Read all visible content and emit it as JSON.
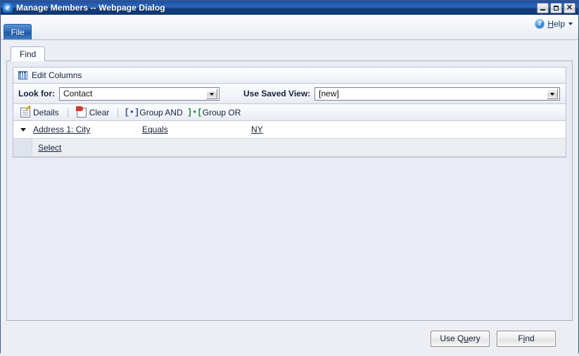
{
  "window": {
    "title": "Manage Members -- Webpage Dialog",
    "app_icon": "internet-explorer-icon",
    "caption_buttons": [
      {
        "name": "minimize",
        "glyph": "minimize-icon"
      },
      {
        "name": "maximize",
        "glyph": "maximize-icon"
      },
      {
        "name": "close",
        "glyph": "close-icon",
        "label": "✕"
      }
    ]
  },
  "ribbon": {
    "file_label": "File",
    "help": {
      "icon": "help-circle-icon",
      "label_prefix": "",
      "label_accesskey": "H",
      "label_rest": "elp",
      "caret": "chevron-down-icon"
    }
  },
  "tabs": [
    {
      "label": "Find",
      "active": true
    }
  ],
  "edit_columns": {
    "icon": "grid-columns-icon",
    "label": "Edit Columns"
  },
  "look_for": {
    "label": "Look for:",
    "value": "Contact",
    "dropdown_icon": "chevron-down-icon"
  },
  "saved_view": {
    "label": "Use Saved View:",
    "value": "[new]",
    "dropdown_icon": "chevron-down-icon"
  },
  "criteria_toolbar": [
    {
      "label": "Details",
      "icon": "details-icon"
    },
    {
      "label": "Clear",
      "icon": "clear-flag-icon"
    },
    {
      "label": "Group AND",
      "icon": "group-and-icon",
      "glyph": "[•]"
    },
    {
      "label": "Group OR",
      "icon": "group-or-icon",
      "glyph": "]•["
    }
  ],
  "criteria_rows": [
    {
      "expander": "chevron-down-icon",
      "field": "Address 1: City",
      "operator": "Equals",
      "value": "NY"
    }
  ],
  "select_row": {
    "label": "Select"
  },
  "footer": {
    "use_query": {
      "prefix": "Use Q",
      "accesskey": "u",
      "suffix": "ery"
    },
    "find": {
      "prefix": "F",
      "accesskey": "i",
      "suffix": "nd"
    }
  }
}
